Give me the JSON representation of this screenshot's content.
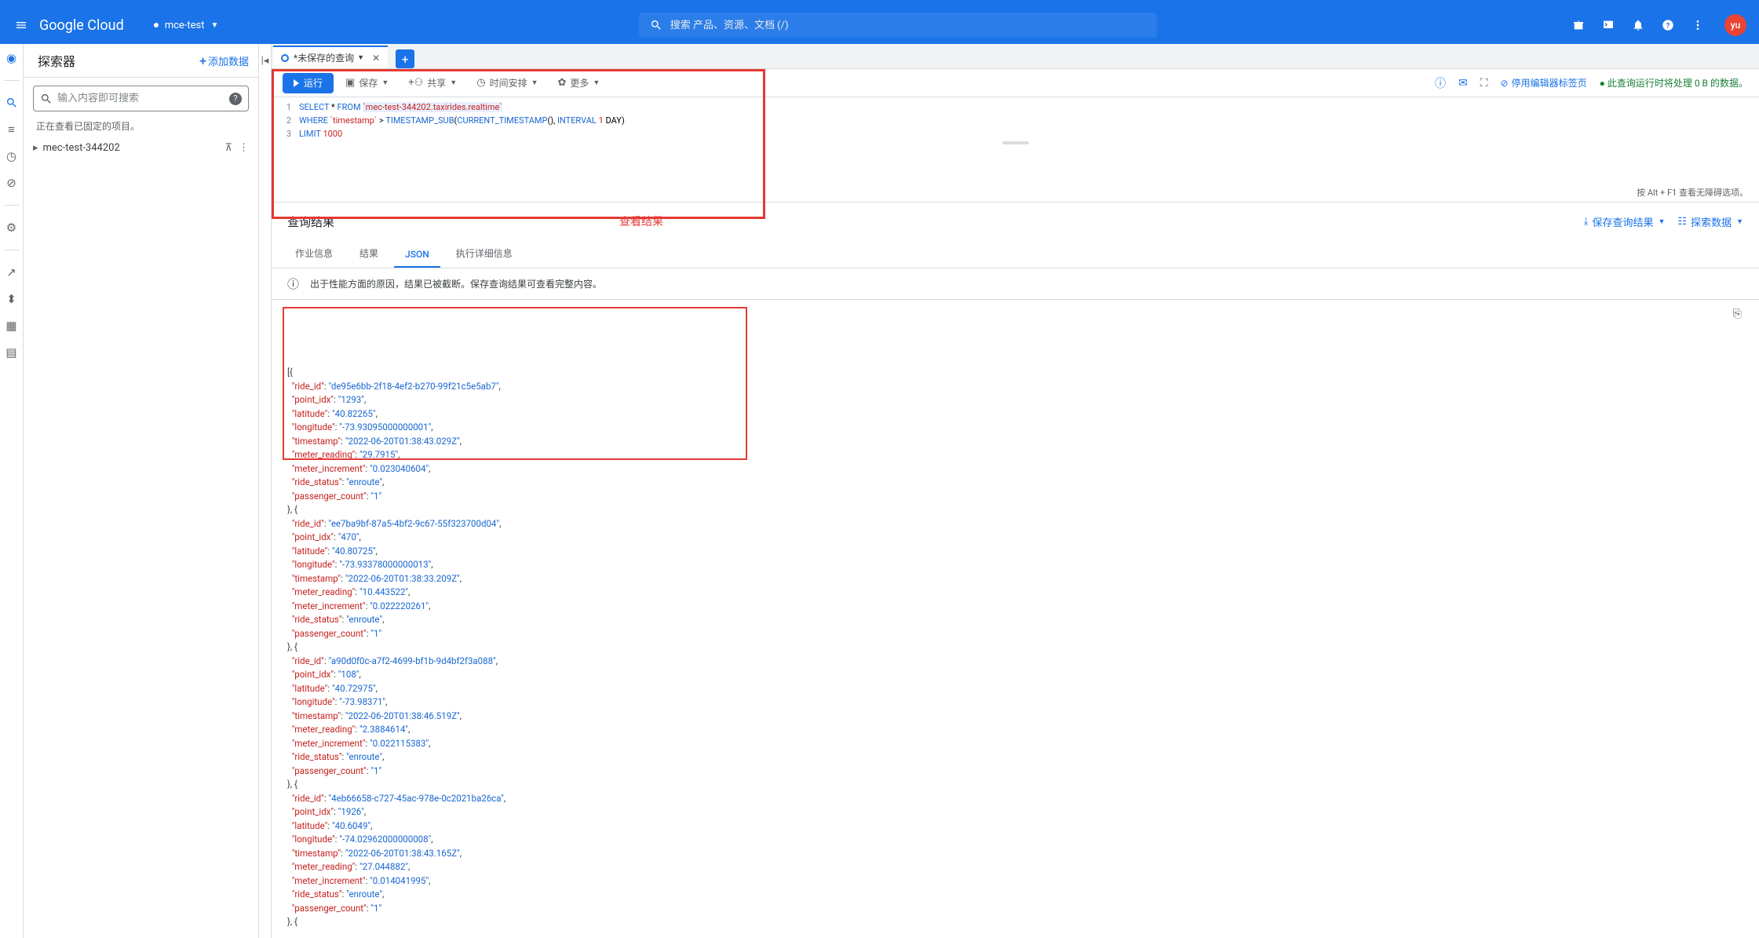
{
  "header": {
    "logo": "Google Cloud",
    "project": "mce-test",
    "search_placeholder": "搜索 产品、资源、文档 (/)",
    "avatar": "yu"
  },
  "explorer": {
    "title": "探索器",
    "add": "添加数据",
    "search_placeholder": "输入内容即可搜索",
    "note": "正在查看已固定的项目。",
    "project_item": "mec-test-344202"
  },
  "tab": {
    "label": "*未保存的查询"
  },
  "toolbar": {
    "run": "运行",
    "save": "保存",
    "share": "共享",
    "schedule": "时间安排",
    "more": "更多",
    "status": "此查询运行时将处理 0 B 的数据。",
    "stop": "停用编辑器标签页"
  },
  "sql": {
    "line1_pre": "SELECT * FROM ",
    "line1_table": "`mec-test-344202.taxirides.realtime`",
    "line2_a": "WHERE ",
    "line2_b": "`timestamp`",
    "line2_c": " > TIMESTAMP_SUB(CURRENT_TIMESTAMP(), INTERVAL ",
    "line2_d": "1",
    "line2_e": " DAY)",
    "line3_a": "LIMIT ",
    "line3_b": "1000"
  },
  "hint": "按 Alt + F1 查看无障碍选项。",
  "results": {
    "title": "查询结果",
    "red_label": "查看结果",
    "save_results": "保存查询结果",
    "explore_data": "探索数据",
    "tabs": [
      "作业信息",
      "结果",
      "JSON",
      "执行详细信息"
    ],
    "info": "出于性能方面的原因，结果已被截断。保存查询结果可查看完整内容。"
  },
  "json_records": [
    {
      "ride_id": "de95e6bb-2f18-4ef2-b270-99f21c5e5ab7",
      "point_idx": "1293",
      "latitude": "40.82265",
      "longitude": "-73.93095000000001",
      "timestamp": "2022-06-20T01:38:43.029Z",
      "meter_reading": "29.7915",
      "meter_increment": "0.023040604",
      "ride_status": "enroute",
      "passenger_count": "1"
    },
    {
      "ride_id": "ee7ba9bf-87a5-4bf2-9c67-55f323700d04",
      "point_idx": "470",
      "latitude": "40.80725",
      "longitude": "-73.93378000000013",
      "timestamp": "2022-06-20T01:38:33.209Z",
      "meter_reading": "10.443522",
      "meter_increment": "0.022220261",
      "ride_status": "enroute",
      "passenger_count": "1"
    },
    {
      "ride_id": "a90d0f0c-a7f2-4699-bf1b-9d4bf2f3a088",
      "point_idx": "108",
      "latitude": "40.72975",
      "longitude": "-73.98371",
      "timestamp": "2022-06-20T01:38:46.519Z",
      "meter_reading": "2.3884614",
      "meter_increment": "0.022115383",
      "ride_status": "enroute",
      "passenger_count": "1"
    },
    {
      "ride_id": "4eb66658-c727-45ac-978e-0c2021ba26ca",
      "point_idx": "1926",
      "latitude": "40.6049",
      "longitude": "-74.02962000000008",
      "timestamp": "2022-06-20T01:38:43.165Z",
      "meter_reading": "27.044882",
      "meter_increment": "0.014041995",
      "ride_status": "enroute",
      "passenger_count": "1"
    }
  ]
}
